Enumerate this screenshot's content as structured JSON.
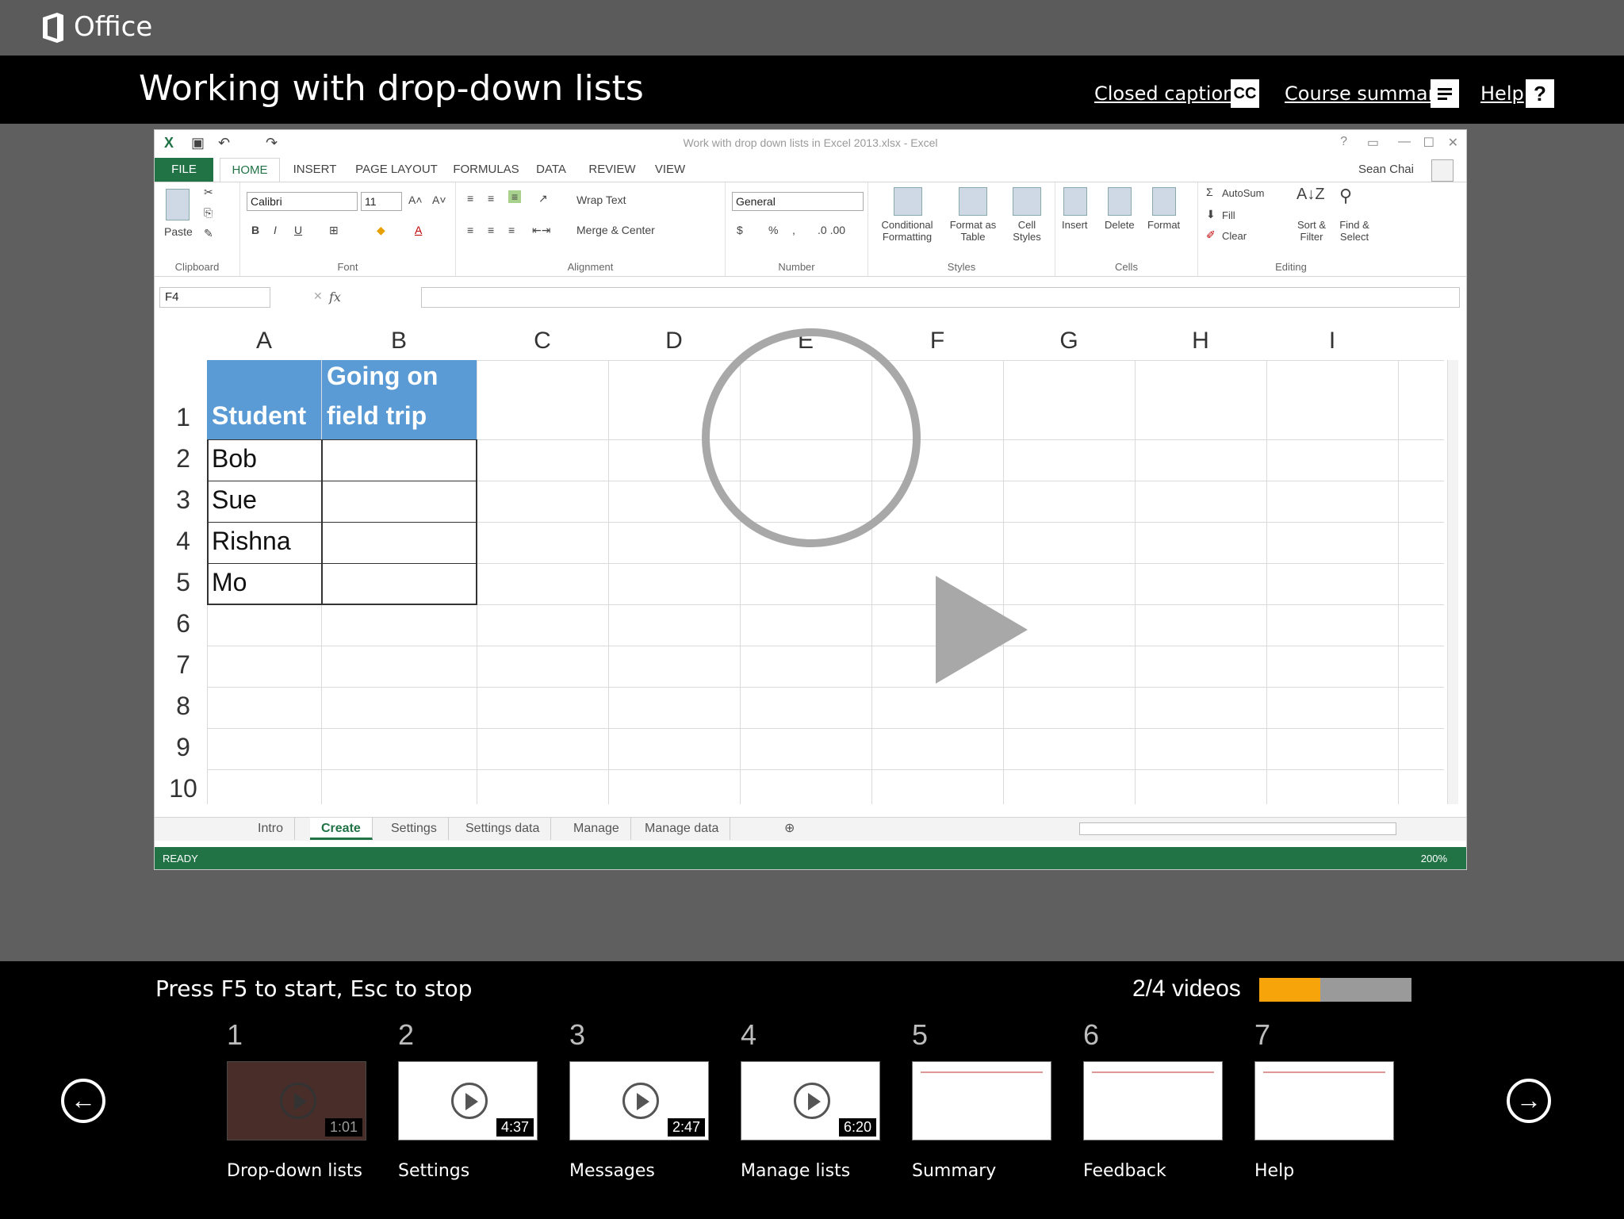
{
  "app": {
    "brand": "Office"
  },
  "course": {
    "title": "Working with drop-down lists"
  },
  "links": {
    "captions": "Closed captions",
    "captions_icon": "CC",
    "summary": "Course summary",
    "help": "Help",
    "help_icon": "?"
  },
  "excel": {
    "doc_title": "Work with drop down lists in Excel 2013.xlsx - Excel",
    "tabs": [
      "FILE",
      "HOME",
      "INSERT",
      "PAGE LAYOUT",
      "FORMULAS",
      "DATA",
      "REVIEW",
      "VIEW"
    ],
    "user": "Sean Chai",
    "ribbon": {
      "paste": "Paste",
      "clipboard": "Clipboard",
      "font_name": "Calibri",
      "font_size": "11",
      "font": "Font",
      "bold": "B",
      "italic": "I",
      "underline": "U",
      "wrap": "Wrap Text",
      "merge": "Merge & Center",
      "alignment": "Alignment",
      "number_format": "General",
      "currency": "$",
      "percent": "%",
      "number": "Number",
      "cond_format": "Conditional Formatting",
      "format_table": "Format as Table",
      "cell_styles": "Cell Styles",
      "styles": "Styles",
      "insert": "Insert",
      "delete": "Delete",
      "format": "Format",
      "cells": "Cells",
      "autosum": "AutoSum",
      "fill": "Fill",
      "clear": "Clear",
      "sort": "Sort & Filter",
      "find": "Find & Select",
      "editing": "Editing"
    },
    "name_box": "F4",
    "fx": "fx",
    "columns": [
      "A",
      "B",
      "C",
      "D",
      "E",
      "F",
      "G",
      "H",
      "I"
    ],
    "rows": [
      "1",
      "2",
      "3",
      "4",
      "5",
      "6",
      "7",
      "8",
      "9",
      "10"
    ],
    "header": {
      "a1": "Student",
      "b1_line1": "Going on",
      "b1_line2": "field trip"
    },
    "students": [
      "Bob",
      "Sue",
      "Rishna",
      "Mo"
    ],
    "sheet_tabs": [
      "Intro",
      "Create",
      "Settings",
      "Settings data",
      "Manage",
      "Manage data"
    ],
    "active_sheet": "Create",
    "status": "READY",
    "zoom": "200%"
  },
  "bottom": {
    "hint": "Press F5 to start, Esc to stop",
    "progress_label": "2/4 videos",
    "progress_fraction": 0.4,
    "thumbs": [
      {
        "num": "1",
        "label": "Drop-down lists",
        "duration": "1:01",
        "video": true
      },
      {
        "num": "2",
        "label": "Settings",
        "duration": "4:37",
        "video": true
      },
      {
        "num": "3",
        "label": "Messages",
        "duration": "2:47",
        "video": true
      },
      {
        "num": "4",
        "label": "Manage lists",
        "duration": "6:20",
        "video": true
      },
      {
        "num": "5",
        "label": "Summary",
        "duration": "",
        "video": false
      },
      {
        "num": "6",
        "label": "Feedback",
        "duration": "",
        "video": false
      },
      {
        "num": "7",
        "label": "Help",
        "duration": "",
        "video": false
      }
    ]
  },
  "colors": {
    "excel_green": "#217346",
    "header_blue": "#5b9bd5",
    "progress": "#f7a30a"
  }
}
